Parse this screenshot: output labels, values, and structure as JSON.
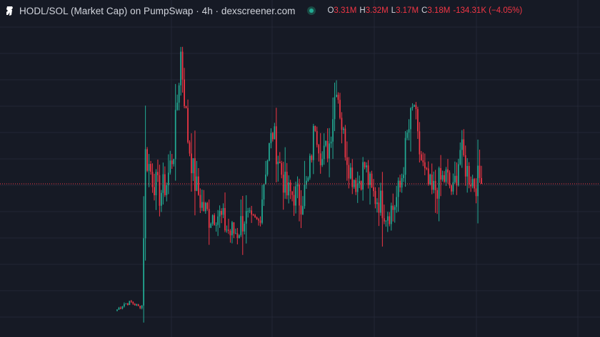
{
  "header": {
    "title": "HODL/SOL (Market Cap) on PumpSwap · 4h · dexscreener.com",
    "ohlc": {
      "o_label": "O",
      "o": "3.31M",
      "h_label": "H",
      "h": "3.32M",
      "l_label": "L",
      "l": "3.17M",
      "c_label": "C",
      "c": "3.18M",
      "change": "-134.31K (−4.05%)"
    }
  },
  "colors": {
    "background": "#161a25",
    "grid": "#232735",
    "up": "#22ab94",
    "down": "#f23645",
    "last_price_line": "#f23645"
  },
  "chart_data": {
    "type": "candlestick",
    "title": "HODL/SOL (Market Cap)",
    "interval": "4h",
    "grid": true,
    "y_range": [
      0.5,
      6.0
    ],
    "y_unit": "M",
    "last_close": 3.18,
    "key_points": [
      [
        0,
        0.95
      ],
      [
        4,
        1.05
      ],
      [
        8,
        1.08
      ],
      [
        12,
        1.0
      ],
      [
        14,
        1.02
      ],
      [
        16,
        3.7
      ],
      [
        20,
        3.3
      ],
      [
        24,
        3.0
      ],
      [
        28,
        3.2
      ],
      [
        32,
        3.8
      ],
      [
        36,
        5.5
      ],
      [
        40,
        4.0
      ],
      [
        44,
        3.2
      ],
      [
        48,
        2.8
      ],
      [
        52,
        2.6
      ],
      [
        56,
        2.7
      ],
      [
        60,
        2.5
      ],
      [
        64,
        2.3
      ],
      [
        68,
        2.35
      ],
      [
        72,
        2.6
      ],
      [
        76,
        2.4
      ],
      [
        80,
        2.5
      ],
      [
        84,
        3.5
      ],
      [
        88,
        4.1
      ],
      [
        92,
        3.5
      ],
      [
        96,
        3.0
      ],
      [
        100,
        3.0
      ],
      [
        104,
        2.9
      ],
      [
        108,
        3.2
      ],
      [
        112,
        4.3
      ],
      [
        116,
        3.6
      ],
      [
        120,
        3.9
      ],
      [
        124,
        5.0
      ],
      [
        128,
        4.0
      ],
      [
        132,
        3.4
      ],
      [
        136,
        3.2
      ],
      [
        140,
        3.5
      ],
      [
        144,
        3.0
      ],
      [
        148,
        2.9
      ],
      [
        152,
        2.7
      ],
      [
        156,
        2.75
      ],
      [
        160,
        3.1
      ],
      [
        164,
        4.0
      ],
      [
        168,
        4.6
      ],
      [
        170,
        3.9
      ],
      [
        174,
        3.3
      ],
      [
        178,
        3.0
      ],
      [
        182,
        3.2
      ],
      [
        186,
        3.3
      ],
      [
        190,
        3.0
      ],
      [
        194,
        3.8
      ],
      [
        198,
        3.4
      ],
      [
        202,
        3.2
      ],
      [
        206,
        3.3
      ]
    ]
  }
}
